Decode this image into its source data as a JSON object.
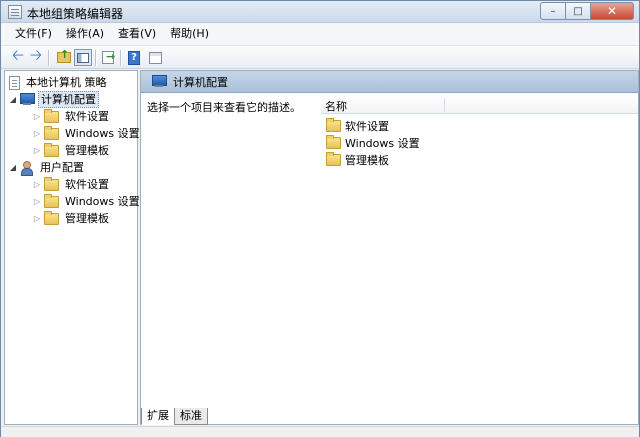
{
  "window": {
    "title": "本地组策略编辑器",
    "controls": {
      "minimize": "–",
      "maximize": "□",
      "close": "✕"
    }
  },
  "menu": [
    "文件(F)",
    "操作(A)",
    "查看(V)",
    "帮助(H)"
  ],
  "toolbar": {
    "help_glyph": "?",
    "icons": [
      "back-arrow-icon",
      "forward-arrow-icon",
      "up-folder-icon",
      "show-console-tree-icon",
      "export-list-icon",
      "help-icon",
      "properties-icon"
    ]
  },
  "tree": {
    "root": "本地计算机 策略",
    "computer": {
      "label": "计算机配置",
      "children": [
        "软件设置",
        "Windows 设置",
        "管理模板"
      ]
    },
    "user": {
      "label": "用户配置",
      "children": [
        "软件设置",
        "Windows 设置",
        "管理模板"
      ]
    }
  },
  "detail": {
    "header": "计算机配置",
    "description": "选择一个项目来查看它的描述。",
    "column_name": "名称",
    "items": [
      "软件设置",
      "Windows 设置",
      "管理模板"
    ]
  },
  "tabs": [
    "扩展",
    "标准"
  ],
  "colors": {
    "title_bar": "#cbd9ea",
    "panel_header": "#a9c0d9",
    "folder": "#e8c15a",
    "close_button": "#c74a36"
  }
}
